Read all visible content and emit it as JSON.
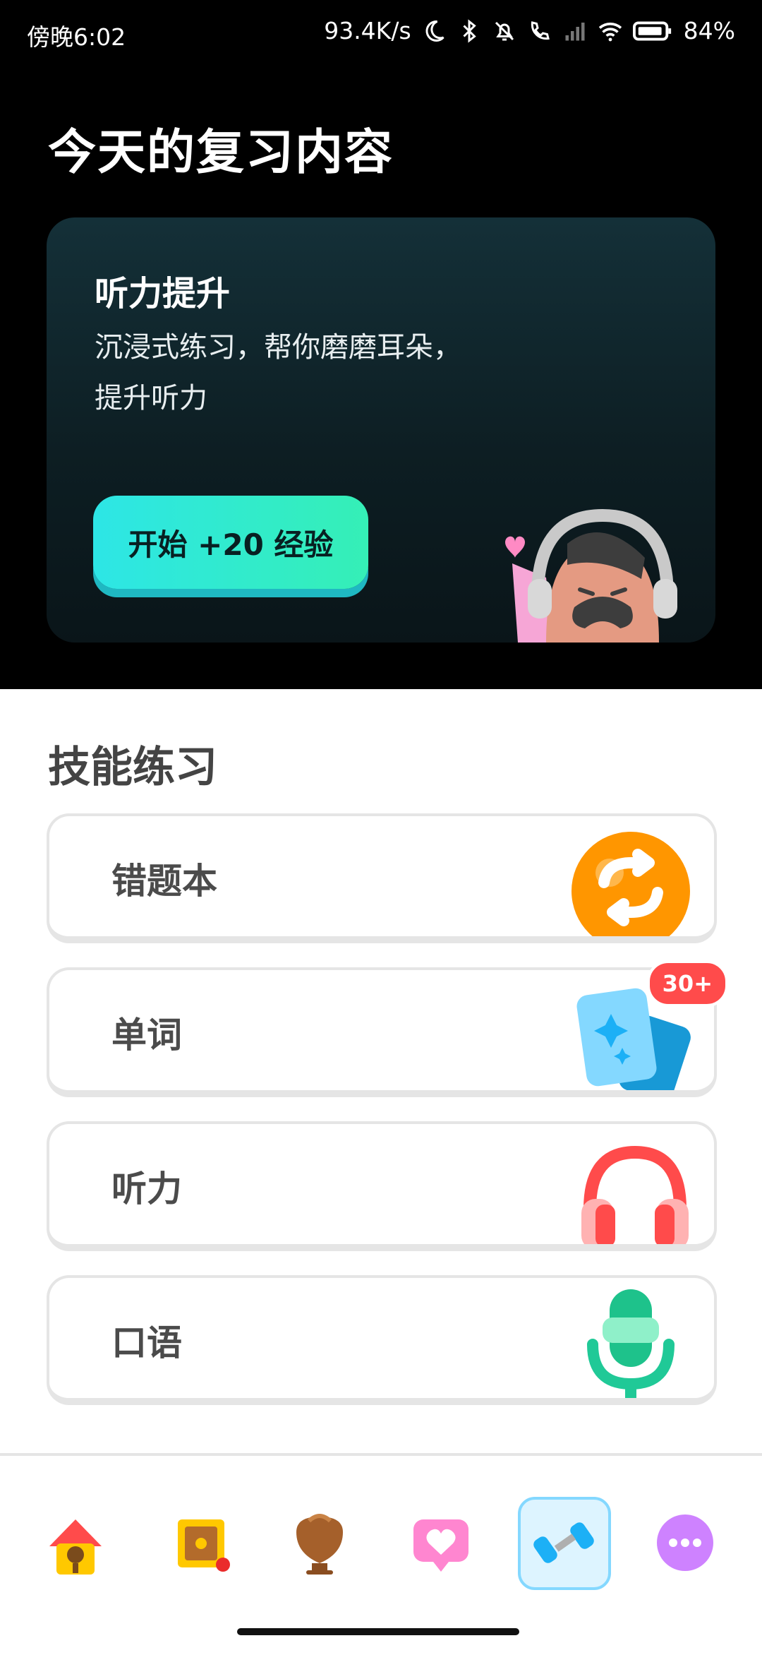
{
  "status": {
    "time": "傍晚6:02",
    "speed": "93.4K/s",
    "battery": "84%"
  },
  "page": {
    "title": "今天的复习内容"
  },
  "review_card": {
    "title": "听力提升",
    "description": "沉浸式练习，帮你磨磨耳朵，提升听力",
    "button": "开始 +20 经验",
    "mascot_icon": "headphones-character-icon"
  },
  "skills": {
    "title": "技能练习",
    "items": [
      {
        "label": "错题本",
        "icon": "refresh-icon"
      },
      {
        "label": "单词",
        "icon": "flashcards-icon",
        "badge": "30+"
      },
      {
        "label": "听力",
        "icon": "headphones-icon"
      },
      {
        "label": "口语",
        "icon": "microphone-icon"
      }
    ]
  },
  "tabbar": {
    "items": [
      {
        "icon": "home-icon"
      },
      {
        "icon": "treasure-chest-icon"
      },
      {
        "icon": "trophy-shield-icon"
      },
      {
        "icon": "heart-chat-icon"
      },
      {
        "icon": "dumbbell-icon",
        "active": true
      },
      {
        "icon": "more-icon"
      }
    ]
  },
  "colors": {
    "accent": "#2de6e6",
    "badge": "#ff4b4b",
    "active_tab": "#84d8ff"
  }
}
